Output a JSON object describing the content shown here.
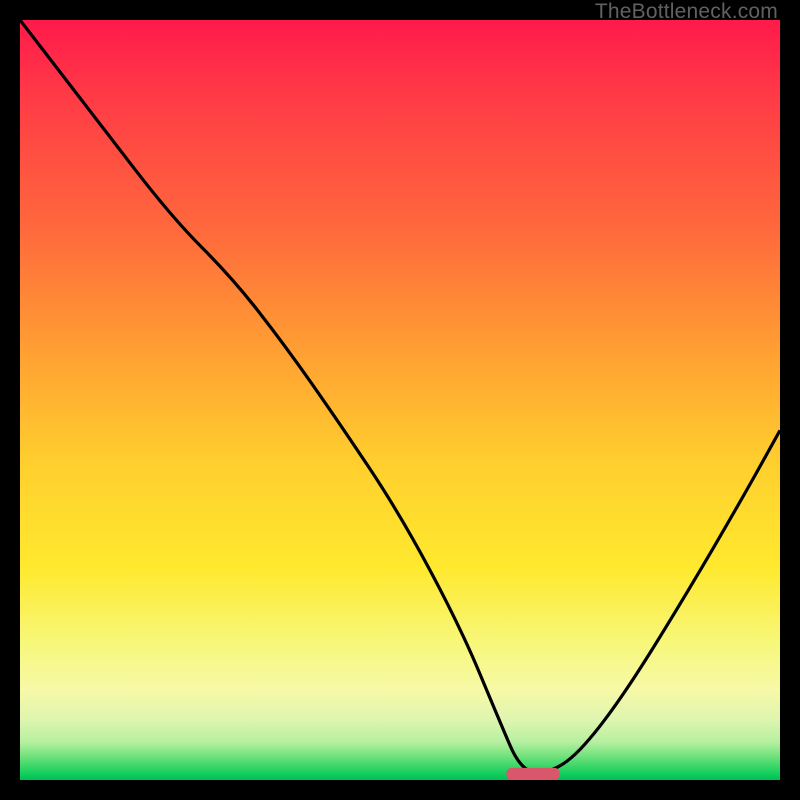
{
  "watermark": "TheBottleneck.com",
  "marker_color": "#d9576b",
  "curve_color": "#000000",
  "chart_data": {
    "type": "line",
    "title": "",
    "xlabel": "",
    "ylabel": "",
    "xlim": [
      0,
      100
    ],
    "ylim": [
      0,
      100
    ],
    "note": "x in percent of width, y in percent of height measured from bottom (0) to top (100). Curve represents bottleneck percentage vs. some parameter; minimum near x≈67.",
    "series": [
      {
        "name": "bottleneck-curve",
        "x": [
          0,
          10,
          20,
          28,
          35,
          42,
          50,
          58,
          63,
          66,
          70,
          74,
          80,
          88,
          95,
          100
        ],
        "y": [
          100,
          87,
          74,
          66,
          57,
          47,
          35,
          20,
          8,
          1,
          1,
          4,
          12,
          25,
          37,
          46
        ]
      }
    ],
    "minimum_marker": {
      "x_start": 64,
      "x_end": 71,
      "y": 0.8
    }
  }
}
